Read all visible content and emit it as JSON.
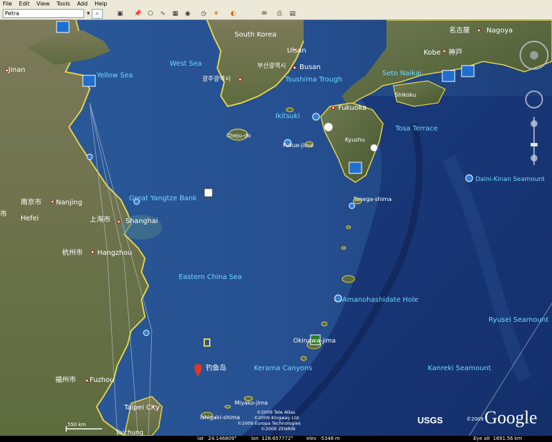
{
  "menu": [
    "File",
    "Edit",
    "View",
    "Tools",
    "Add",
    "Help"
  ],
  "search": {
    "value": "Petra"
  },
  "toolbar_icons": [
    "search-icon",
    "sidebar-toggle-icon",
    "placemark-icon",
    "polygon-icon",
    "path-icon",
    "image-overlay-icon",
    "record-tour-icon",
    "historical-imagery-icon",
    "sunlight-icon",
    "switch-to-sky-icon",
    "email-icon",
    "print-icon",
    "view-in-maps-icon"
  ],
  "labels": {
    "south_korea": "South Korea",
    "ulsan": "Ulsan",
    "busan_ko": "부산광역시",
    "busan": "Busan",
    "gwangju": "광주광역시",
    "west_sea": "West Sea",
    "yellow_sea": "Yellow Sea",
    "jinan": "Jinan",
    "tsushima": "Tsushima Trough",
    "ikitsuki": "Ikitsuki",
    "fukuoka": "Fukuoka",
    "seto_naikai": "Seto Naikai",
    "shikoku": "Shikoku",
    "kyushu": "Kyushu",
    "tosa_terrace": "Tosa Terrace",
    "fukue_jima": "Fukue-jima",
    "cheju_do": "Cheju-do",
    "nagoya_cn": "名古屋",
    "nagoya": "Nagoya",
    "kobe": "Kobe",
    "kobe_jp": "神戸",
    "daini_kinan": "Daini-Kinan Seamount",
    "tanegashima": "Tanega-shima",
    "great_yangtze": "Great Yangtze Bank",
    "nanjing_cn": "南京市",
    "nanjing": "Nanjing",
    "hefei": "Hefei",
    "hefei_cn": "市",
    "shanghai_cn": "上海市",
    "shanghai": "Shanghai",
    "hangzhou_cn": "杭州市",
    "hangzhou": "Hangzhou",
    "eastern_china_sea": "Eastern China Sea",
    "amanohashidate": "Amanohashidate Hole",
    "ryusei": "Ryusei Seamount",
    "okinawa": "Okinawa-jima",
    "kerama": "Kerama Canyons",
    "kanreki": "Kanreki Seamount",
    "fuzhou_cn": "福州市",
    "fuzhou": "Fuzhou",
    "diaoyu": "钓鱼岛",
    "miyako": "Miyako-jima",
    "taipei": "Taipei City",
    "ishigaki": "Ishigaki-shima",
    "taichung": "Taichung"
  },
  "attribution": [
    "©2009 Tele Atlas",
    "©2009 Kingway Ltd.",
    "©2009 Europa Technologies",
    "©2009 ZENRIN"
  ],
  "copyright_year": "©2009",
  "usgs": "USGS",
  "google": "Google",
  "scale": "550 km",
  "status": {
    "lat": "lat   24.146809°",
    "lon": "lon  128.657772°",
    "elev": "elev  -5348 m",
    "eye": "Eye alt  1691.56 km"
  }
}
